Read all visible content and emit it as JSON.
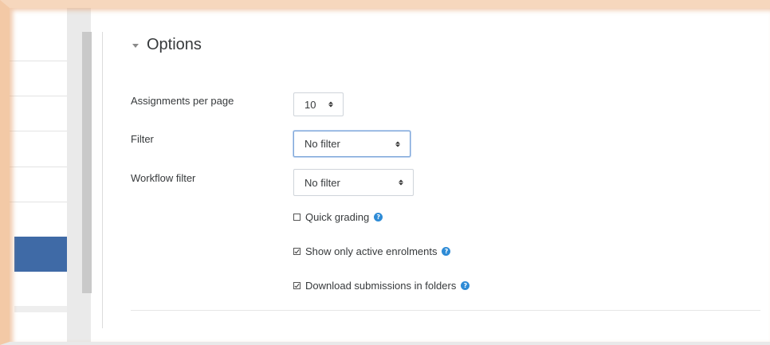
{
  "section": {
    "title": "Options"
  },
  "fields": {
    "assignments_per_page": {
      "label": "Assignments per page",
      "value": "10"
    },
    "filter": {
      "label": "Filter",
      "value": "No filter"
    },
    "workflow_filter": {
      "label": "Workflow filter",
      "value": "No filter"
    }
  },
  "checkboxes": [
    {
      "label": "Quick grading",
      "checked": false,
      "help_icon": "question-circle-icon"
    },
    {
      "label": "Show only active enrolments",
      "checked": true,
      "help_icon": "question-circle-icon"
    },
    {
      "label": "Download submissions in folders",
      "checked": true,
      "help_icon": "question-circle-icon"
    }
  ],
  "colors": {
    "accent": "#3f6aa6",
    "help_icon": "#2e8bd6",
    "focus_border": "#7fa7d9",
    "frame_glow": "#f3c9a6"
  }
}
